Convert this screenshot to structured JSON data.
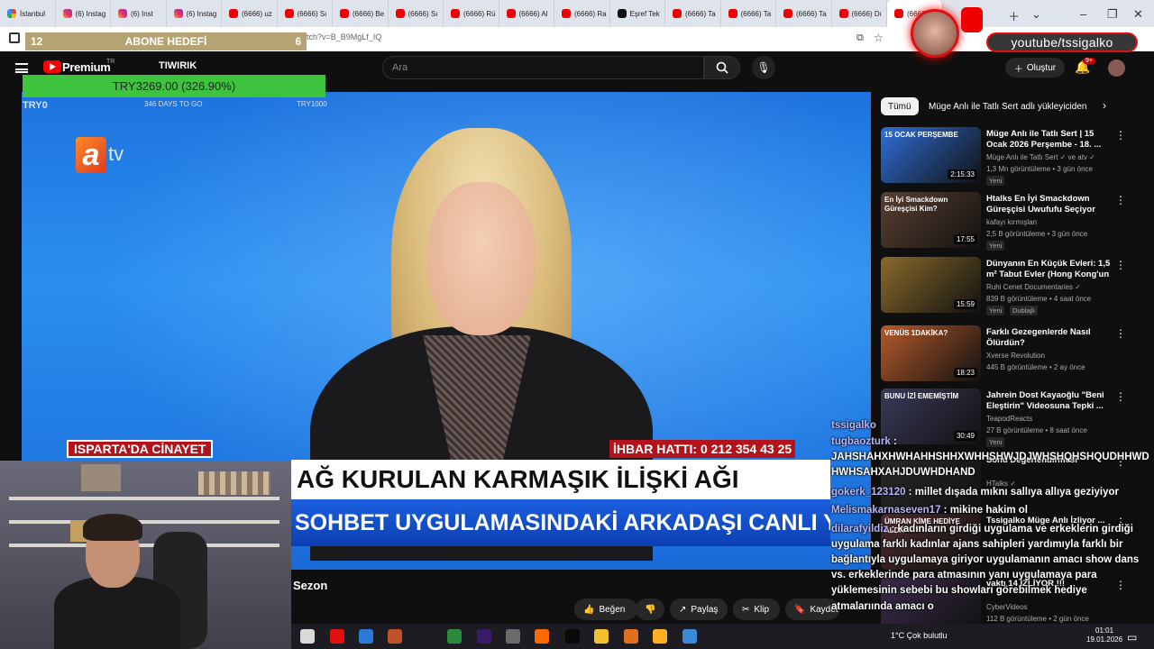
{
  "browser": {
    "tabs": [
      "İstanbul",
      "(6) Instag",
      "(6) Inst",
      "(6) Instag",
      "(6666) uz",
      "(6666) Sı",
      "(6666) Be",
      "(6666) Sı",
      "(6666) Rü",
      "(6666) Al",
      "(6666) Ra",
      "Eşref Tek",
      "(6666) Ta",
      "(6666) Ta",
      "(6666) Ta",
      "(6666) Dı",
      "(6666)"
    ],
    "url": "tch?v=B_B9MgLf_IQ"
  },
  "overlay": {
    "abone_left": "12",
    "abone_title": "ABONE HEDEFİ",
    "abone_right": "6",
    "target_value": "TRY3269.00 (326.90%)",
    "target_start": "TRY0",
    "target_days": "346 DAYS TO GO",
    "target_end": "TRY1000",
    "brand_handle": "youtube/tssigalko"
  },
  "youtube": {
    "logo_text": "Premium",
    "region": "TR",
    "channel_overlay": "TIWIRIK",
    "search_placeholder": "Ara",
    "create_label": "Oluştur",
    "notif_count": "9+"
  },
  "video": {
    "channel_logo": "atv",
    "lower_left": "ISPARTA'DA CİNAYET",
    "lower_right": "İHBAR HATTI: 0 212 354 43 25",
    "headline1": "AĞ KURULAN KARMAŞIK İLİŞKİ AĞI",
    "headline2": "SOHBET UYGULAMASINDAKİ ARKADAŞI CANLI YAYINDA",
    "title_fragment": "Sezon"
  },
  "actions": {
    "like": "Beğen",
    "share": "Paylaş",
    "clip": "Klip",
    "save": "Kaydet"
  },
  "sidebar": {
    "chips": [
      "Tümü",
      "Müge Anlı ile Tatlı Sert adlı yükleyiciden"
    ],
    "items": [
      {
        "title": "Müge Anlı ile Tatlı Sert | 15 Ocak 2026 Perşembe - 18. ...",
        "channel": "Müge Anlı ile Tatlı Sert ✓ ve atv ✓",
        "meta": "1,3 Mn görüntüleme • 3 gün önce",
        "badge": "Yeni",
        "duration": "2:15:33",
        "thumb_text": "15 OCAK PERŞEMBE",
        "color": "#2f6fd8"
      },
      {
        "title": "Htalks En İyi Smackdown Güreşçisi Uwufufu Seçiyor",
        "channel": "kafayı kırmışlan",
        "meta": "2,5 B görüntüleme • 3 gün önce",
        "badge": "Yeni",
        "duration": "17:55",
        "thumb_text": "En İyi Smackdown Güreşçisi Kim?",
        "color": "#5a4030"
      },
      {
        "title": "Dünyanın En Küçük Evleri: 1,5 m² Tabut Evler (Hong Kong'un ...",
        "channel": "Ruhi Cenet Documentaries ✓",
        "meta": "839 B görüntüleme • 4 saat önce",
        "badge": "Yeni",
        "extra": "Dublajlı",
        "duration": "15:59",
        "thumb_text": "",
        "color": "#8a6a2a"
      },
      {
        "title": "Farklı Gezegenlerde Nasıl Ölürdün?",
        "channel": "Xverse Revolution",
        "meta": "445 B görüntüleme • 2 ay önce",
        "badge": "",
        "duration": "18:23",
        "thumb_text": "VENÜS 1DAKİKA?",
        "color": "#b65a2a"
      },
      {
        "title": "Jahrein Dost Kayaoğlu \"Beni Eleştirin\" Videosuna Tepki ...",
        "channel": "TeapodReacts",
        "meta": "27 B görüntüleme • 8 saat önce",
        "badge": "Yeni",
        "duration": "30:49",
        "thumb_text": "BUNU İZİ EMEMİŞTİM",
        "color": "#3a3a5a"
      },
      {
        "title": "Sonu Değerlendirmesi",
        "channel": "HTalks ✓",
        "meta": "",
        "badge": "",
        "duration": "",
        "thumb_text": "",
        "color": "#2a2a2a"
      },
      {
        "title": "Tssigalko Müge Anlı İzliyor ...",
        "channel": "",
        "meta": "",
        "badge": "",
        "duration": "",
        "thumb_text": "ÜMRAN KİME HEDİYE ALDI?",
        "color": "#4a2a2a"
      },
      {
        "title": "vaktı 14 İZLİYOR !!!",
        "channel": "CyberVideos",
        "meta": "112 B görüntüleme • 2 gün önce",
        "badge": "",
        "duration": "",
        "thumb_text": "",
        "color": "#3a2a4a"
      }
    ]
  },
  "chat": [
    {
      "user": "tssigalko",
      "text": ""
    },
    {
      "user": "tugbaozturk",
      "text": " :"
    },
    {
      "user": "",
      "text": "JAHSHAHXHWHAHHSHHXWHHSHWJDJWHSHQHSHQUDHHWD"
    },
    {
      "user": "",
      "text": "HWHSAHXAHJDUWHDHAND"
    },
    {
      "user": "gokerk_123120",
      "text": " : millet dışada mıknı sallıya allıya geziyiyor"
    },
    {
      "user": "Melismakarnaseven17",
      "text": " : mikine hakim ol"
    },
    {
      "user": "dilarafyildiz",
      "text": " : kadınların girdiği uygulama ve erkeklerin girdiği"
    },
    {
      "user": "",
      "text": "uygulama farklı kadınlar ajans sahipleri yardımıyla farklı bir"
    },
    {
      "user": "",
      "text": "bağlantıyla uygulamaya giriyor uygulamanın amacı show dans"
    },
    {
      "user": "",
      "text": "vs. erkeklerinde para atmasının yanı uygulamaya para"
    },
    {
      "user": "",
      "text": "yüklemesinin sebebi bu showları görebilmek hediye"
    },
    {
      "user": "",
      "text": "atmalarıında amacı o"
    }
  ],
  "taskbar": {
    "weather": "1°C  Çok bulutlu",
    "time": "01:01",
    "date": "19.01.2026"
  }
}
